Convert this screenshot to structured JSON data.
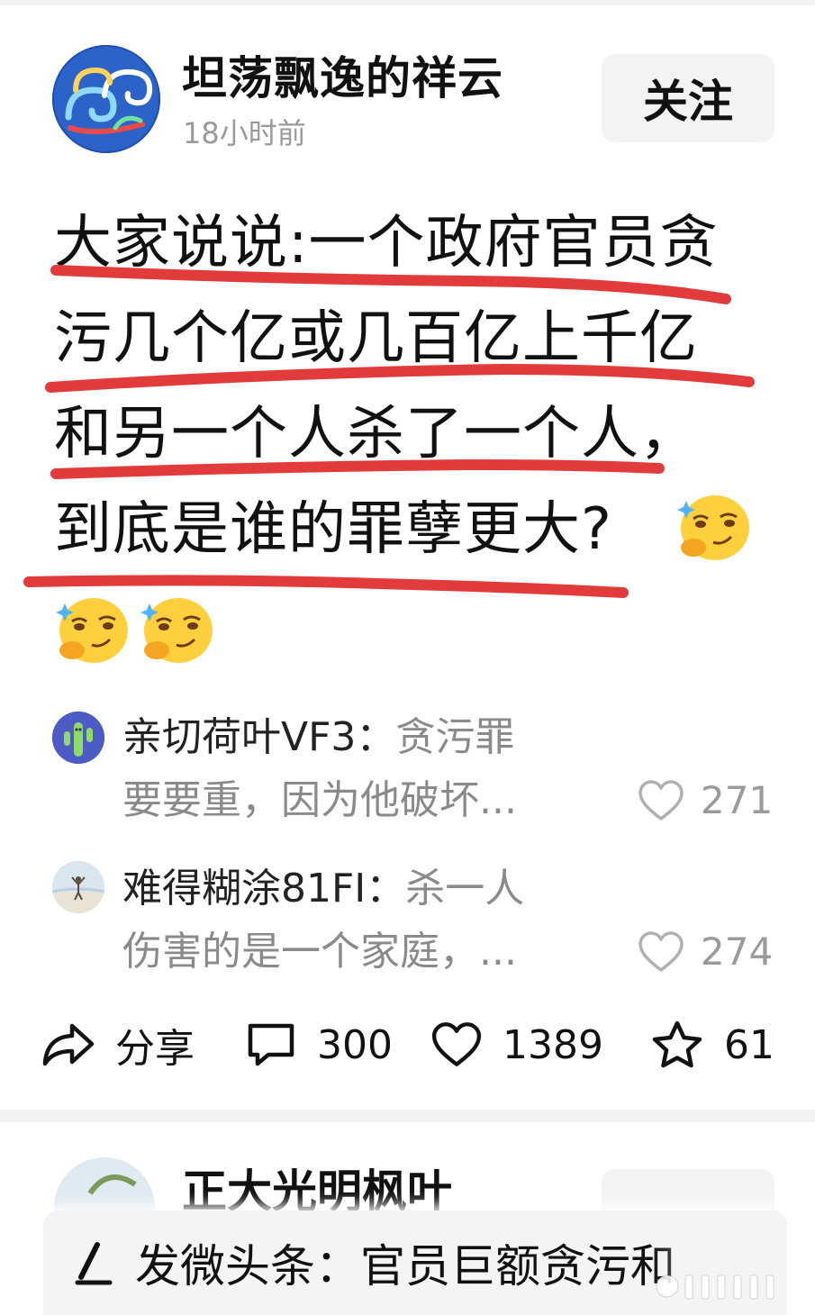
{
  "post": {
    "author": "坦荡飘逸的祥云",
    "time": "18小时前",
    "follow_label": "关注",
    "lines": [
      "大家说说:一个政府官员贪",
      "污几个亿或几百亿上千亿",
      "和另一个人杀了一个人，",
      "到底是谁的罪孽更大?"
    ]
  },
  "comments": [
    {
      "user": "亲切荷叶VF3：",
      "text_line1": "贪污罪",
      "text_line2": "要要重，因为他破坏...",
      "likes": "271"
    },
    {
      "user": "难得糊涂81FI：",
      "text_line1": "杀一人",
      "text_line2": "伤害的是一个家庭，...",
      "likes": "274"
    }
  ],
  "actions": {
    "share_label": "分享",
    "comments_count": "300",
    "likes_count": "1389",
    "favorites_count": "61"
  },
  "next_post": {
    "author": "正大光明枫叶"
  },
  "composer": {
    "text": "发微头条：官员巨额贪污和"
  },
  "colors": {
    "underline": "#e23b3b",
    "muted_text": "#8a8a8a",
    "button_bg": "#f3f3f3"
  }
}
